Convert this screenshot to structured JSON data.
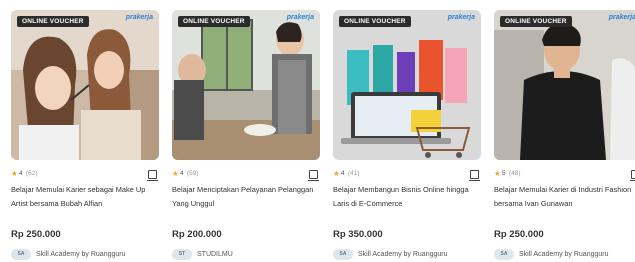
{
  "cards": [
    {
      "badge": "ONLINE VOUCHER",
      "brand": "prakerja",
      "rating": "4",
      "reviews": "(62)",
      "title": "Belajar Memulai Karier sebagai Make Up Artist bersama Bubah Alfian",
      "price": "Rp 250.000",
      "provider_logo": "SA",
      "provider": "Skill Academy by Ruangguru"
    },
    {
      "badge": "ONLINE VOUCHER",
      "brand": "prakerja",
      "rating": "4",
      "reviews": "(59)",
      "title": "Belajar Menciptakan Pelayanan Pelanggan Yang Unggul",
      "price": "Rp 200.000",
      "provider_logo": "ST",
      "provider": "STUDILMU"
    },
    {
      "badge": "ONLINE VOUCHER",
      "brand": "prakerja",
      "rating": "4",
      "reviews": "(41)",
      "title": "Belajar Membangun Bisnis Online hingga Laris di E-Commerce",
      "price": "Rp 350.000",
      "provider_logo": "SA",
      "provider": "Skill Academy by Ruangguru"
    },
    {
      "badge": "ONLINE VOUCHER",
      "brand": "prakerja",
      "rating": "5",
      "reviews": "(48)",
      "title": "Belajar Memulai Karier di Industri Fashion bersama Ivan Gunawan",
      "price": "Rp 250.000",
      "provider_logo": "SA",
      "provider": "Skill Academy by Ruangguru"
    }
  ],
  "icons": {
    "star": "star-icon",
    "bookmark": "bookmark-icon"
  },
  "colors": {
    "star": "#f5a623",
    "brand": "#2f7fd6",
    "badge_bg": "#2b2b2b"
  }
}
